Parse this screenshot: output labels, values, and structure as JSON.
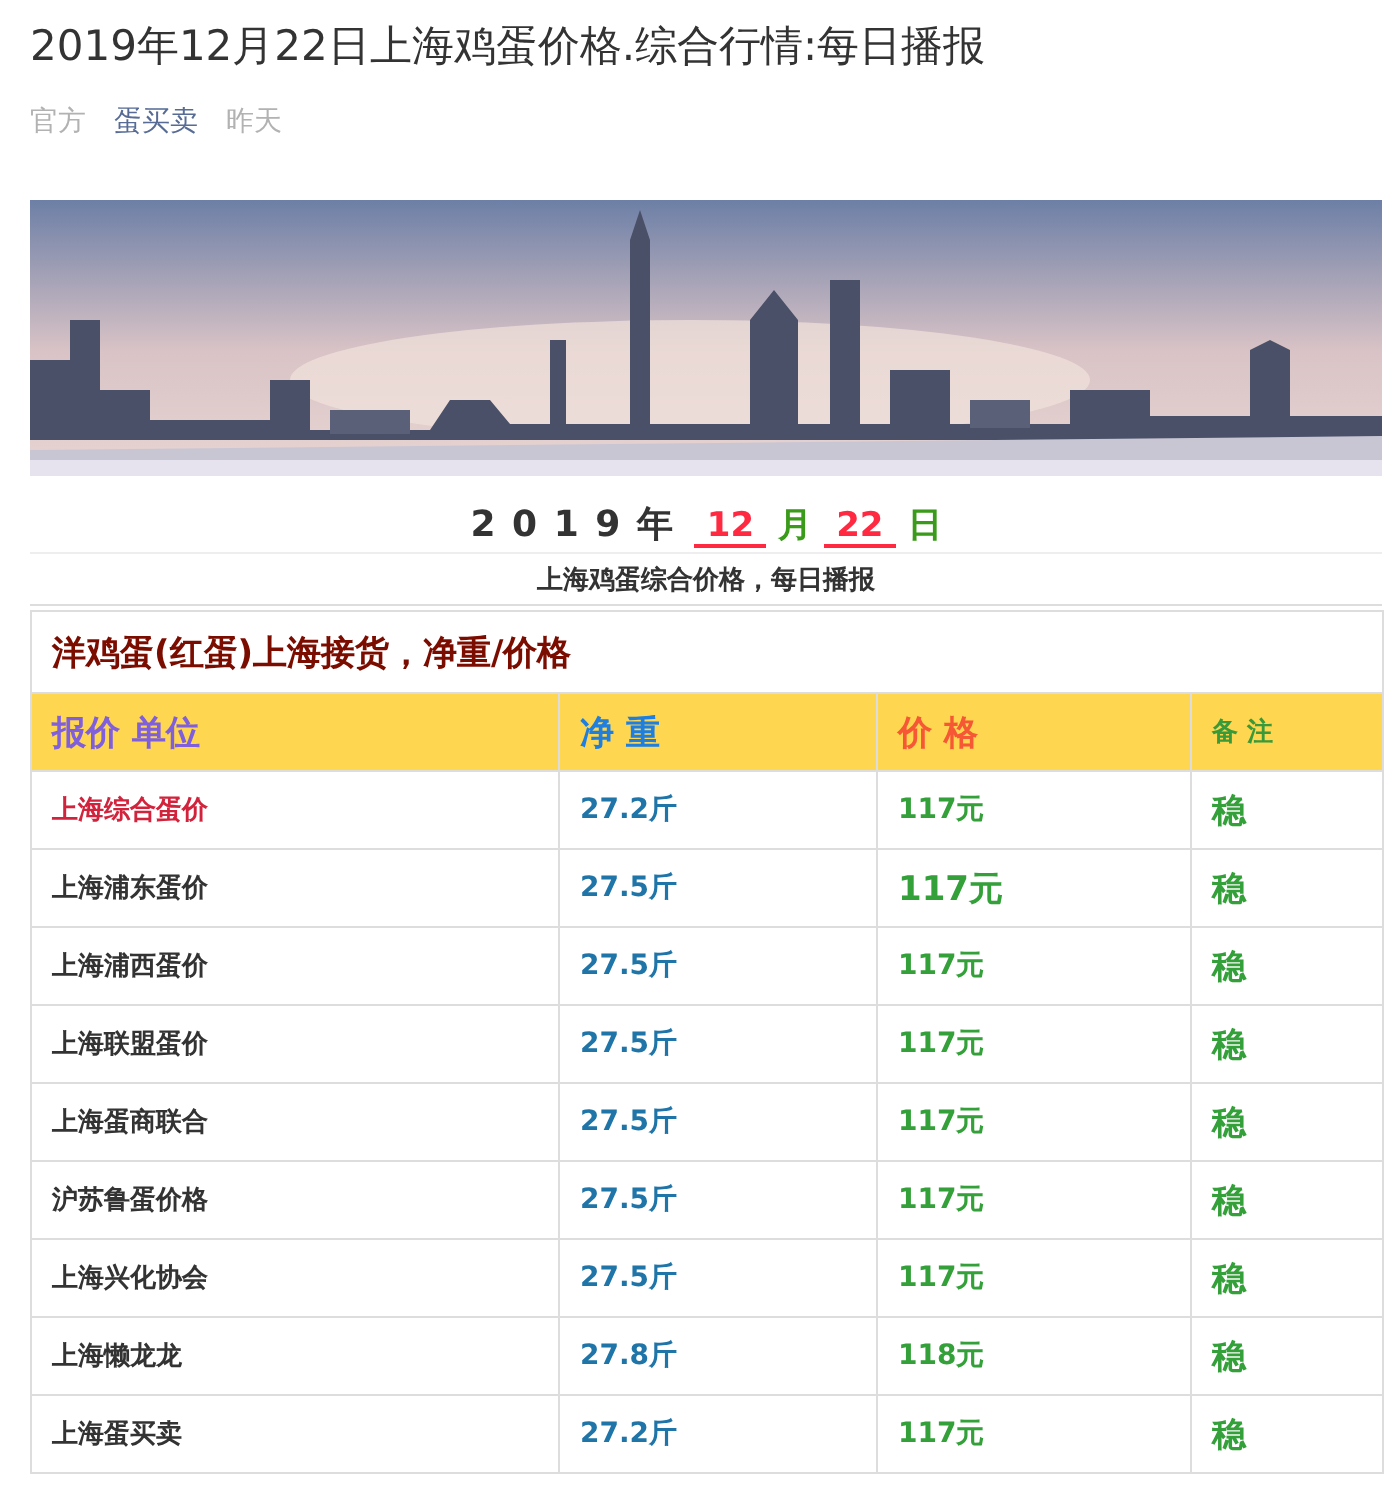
{
  "article": {
    "title": "2019年12月22日上海鸡蛋价格.综合行情:每日播报",
    "source": "官方",
    "author": "蛋买卖",
    "time": "昨天"
  },
  "date_line": {
    "year": "2 0 1 9 年",
    "month": "12",
    "month_unit": "月",
    "day": "22",
    "day_unit": "日"
  },
  "subtitle": "上海鸡蛋综合价格，每日播报",
  "table": {
    "caption": "洋鸡蛋(红蛋)上海接货，净重/价格",
    "columns": [
      "报价 单位",
      "净 重",
      "价 格",
      "备 注"
    ],
    "rows": [
      {
        "name": "上海综合蛋价",
        "weight": "27.2斤",
        "price": "117元",
        "note": "稳",
        "highlight": true,
        "emphasized": false
      },
      {
        "name": "上海浦东蛋价",
        "weight": "27.5斤",
        "price": "117元",
        "note": "稳",
        "highlight": false,
        "emphasized": true
      },
      {
        "name": "上海浦西蛋价",
        "weight": "27.5斤",
        "price": "117元",
        "note": "稳",
        "highlight": false,
        "emphasized": false
      },
      {
        "name": "上海联盟蛋价",
        "weight": "27.5斤",
        "price": "117元",
        "note": "稳",
        "highlight": false,
        "emphasized": false
      },
      {
        "name": "上海蛋商联合",
        "weight": "27.5斤",
        "price": "117元",
        "note": "稳",
        "highlight": false,
        "emphasized": false
      },
      {
        "name": "沪苏鲁蛋价格",
        "weight": "27.5斤",
        "price": "117元",
        "note": "稳",
        "highlight": false,
        "emphasized": false
      },
      {
        "name": "上海兴化协会",
        "weight": "27.5斤",
        "price": "117元",
        "note": "稳",
        "highlight": false,
        "emphasized": false
      },
      {
        "name": "上海懒龙龙",
        "weight": "27.8斤",
        "price": "118元",
        "note": "稳",
        "highlight": false,
        "emphasized": false
      },
      {
        "name": "上海蛋买卖",
        "weight": "27.2斤",
        "price": "117元",
        "note": "稳",
        "highlight": false,
        "emphasized": false
      }
    ]
  }
}
